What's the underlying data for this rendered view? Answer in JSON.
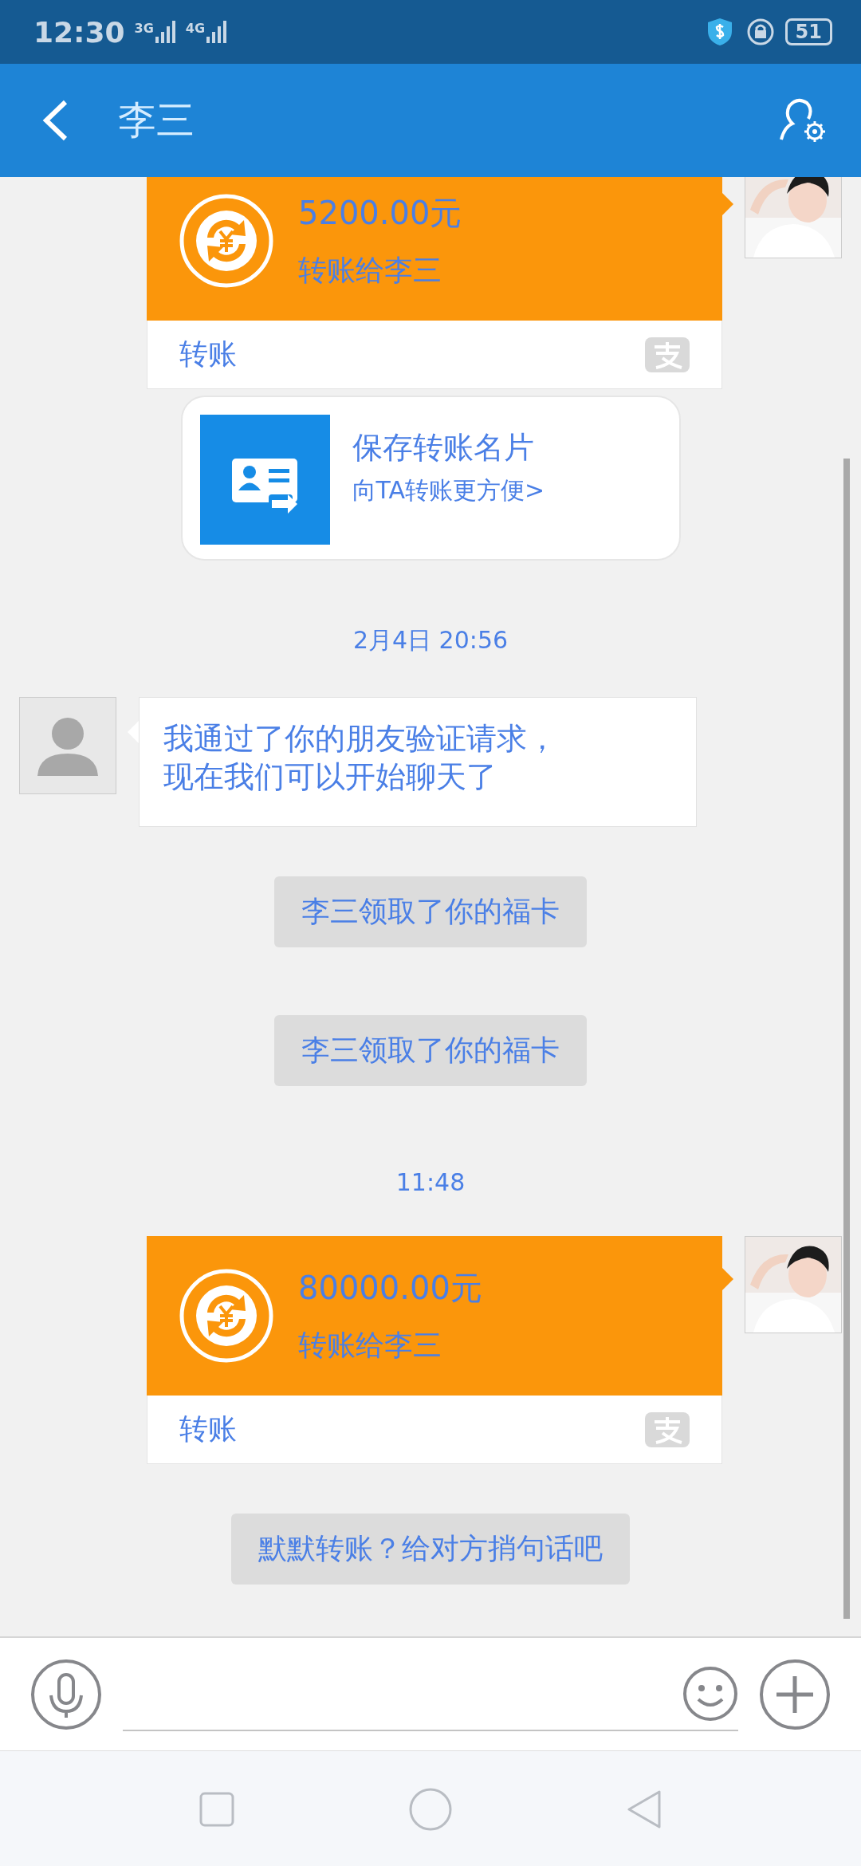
{
  "status_bar": {
    "time": "12:30",
    "networks": [
      "3G",
      "4G"
    ],
    "battery": "51"
  },
  "header": {
    "title": "李三"
  },
  "messages": [
    {
      "kind": "transfer",
      "amount": "5200.00元",
      "note": "转账给李三",
      "footer": "转账"
    },
    {
      "kind": "name_card",
      "title": "保存转账名片",
      "subtitle": "向TA转账更方便>"
    },
    {
      "kind": "timestamp",
      "text": "2月4日 20:56"
    },
    {
      "kind": "text",
      "lines": [
        "我通过了你的朋友验证请求，",
        "现在我们可以开始聊天了"
      ]
    },
    {
      "kind": "system",
      "text": "李三领取了你的福卡"
    },
    {
      "kind": "system",
      "text": "李三领取了你的福卡"
    },
    {
      "kind": "timestamp",
      "text": "11:48"
    },
    {
      "kind": "transfer",
      "amount": "80000.00元",
      "note": "转账给李三",
      "footer": "转账"
    },
    {
      "kind": "system",
      "text": "默默转账？给对方捎句话吧"
    }
  ]
}
